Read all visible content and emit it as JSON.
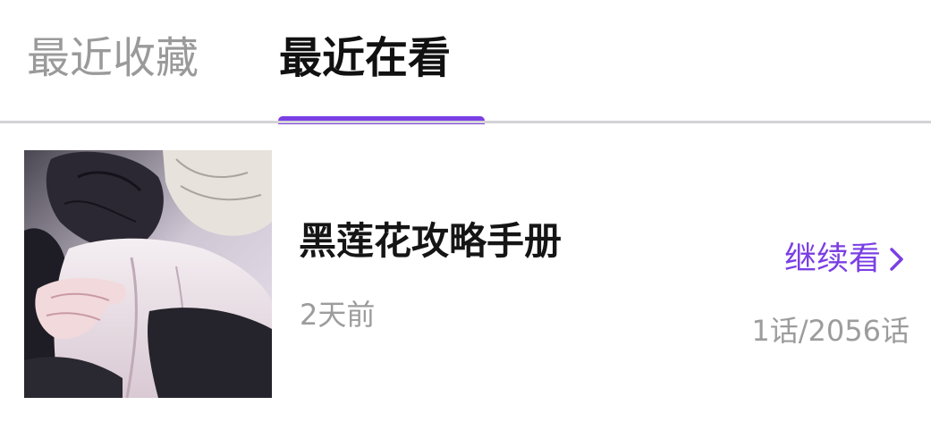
{
  "tabs": [
    {
      "label": "最近收藏",
      "active": false
    },
    {
      "label": "最近在看",
      "active": true
    }
  ],
  "colors": {
    "accent": "#7b3fe4",
    "inactive_text": "#9a9a9a"
  },
  "items": [
    {
      "title": "黑莲花攻略手册",
      "time": "2天前",
      "action": "继续看",
      "action_icon": "chevron-right-icon",
      "progress": "1话/2056话"
    }
  ]
}
